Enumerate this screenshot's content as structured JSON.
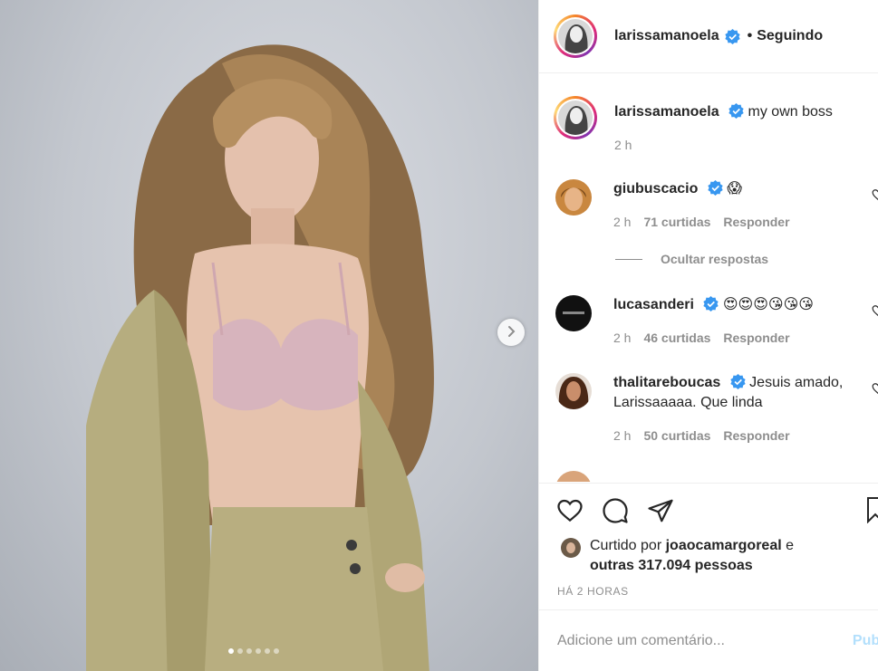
{
  "post": {
    "username": "larissamanoela",
    "separator": "•",
    "follow_status": "Seguindo",
    "caption": "my own boss",
    "caption_time": "2 h"
  },
  "comments": [
    {
      "username": "giubuscacio",
      "text": "😱",
      "time": "2 h",
      "likes": "71 curtidas",
      "reply": "Responder"
    },
    {
      "username": "lucasanderi",
      "text": "😍😍😍😘😘😘",
      "time": "2 h",
      "likes": "46 curtidas",
      "reply": "Responder"
    },
    {
      "username": "thalitareboucas",
      "text": "Jesuis amado, Larissaaaaa. Que linda",
      "time": "2 h",
      "likes": "50 curtidas",
      "reply": "Responder"
    }
  ],
  "hide_replies": "Ocultar respostas",
  "likes": {
    "prefix": "Curtido por",
    "user": "joaocamargoreal",
    "conj": "e",
    "others": "outras 317.094 pessoas"
  },
  "post_time": "HÁ 2 HORAS",
  "comment_box": {
    "placeholder": "Adicione um comentário...",
    "publish": "Publi"
  },
  "icons": {
    "like": "heart-icon",
    "comment": "comment-icon",
    "share": "share-icon",
    "save": "bookmark-icon",
    "next": "chevron-right-icon",
    "verified": "verified-badge-icon"
  },
  "carousel": {
    "slide_count": 6,
    "active_slide": 1
  },
  "colors": {
    "verified": "#3897f0",
    "publish": "#b2dffc",
    "muted": "#8e8e8e"
  }
}
